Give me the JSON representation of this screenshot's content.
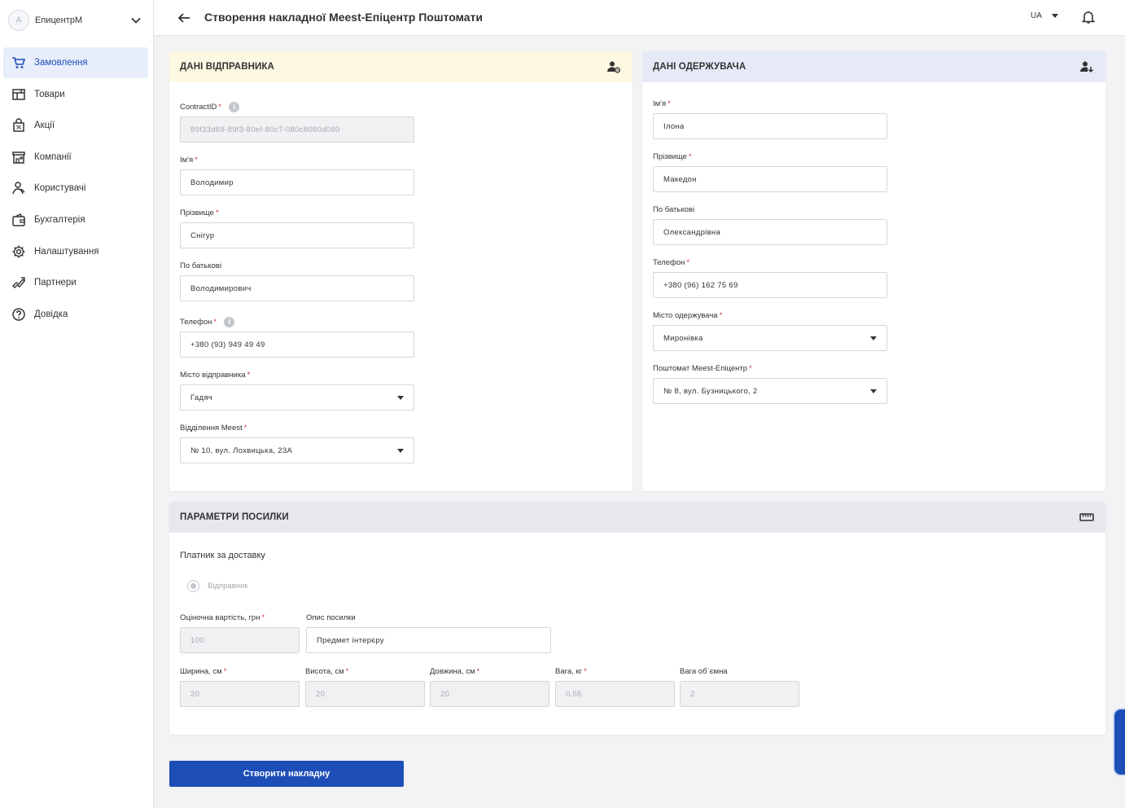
{
  "sidebar": {
    "account": {
      "avatar_letter": "A",
      "name": "ЕпицентрМ"
    },
    "items": [
      {
        "label": "Замовлення",
        "icon": "cart-icon",
        "active": true
      },
      {
        "label": "Товари",
        "icon": "store-icon"
      },
      {
        "label": "Акції",
        "icon": "promo-icon"
      },
      {
        "label": "Компанії",
        "icon": "building-icon"
      },
      {
        "label": "Користувачі",
        "icon": "users-icon"
      },
      {
        "label": "Бухгалтерія",
        "icon": "wallet-icon"
      },
      {
        "label": "Налаштування",
        "icon": "gear-icon"
      },
      {
        "label": "Партнери",
        "icon": "handshake-icon"
      },
      {
        "label": "Довідка",
        "icon": "help-icon"
      }
    ]
  },
  "header": {
    "title": "Створення накладної Meest-Епіцентр Поштомати",
    "lang": "UA"
  },
  "sender": {
    "title": "ДАНІ ВІДПРАВНИКА",
    "contract_label": "ContractID",
    "contract_value": "89f33d69-89f3-80ef-80c7-080c8080d080",
    "first_name_label": "Ім'я",
    "first_name": "Володимир",
    "last_name_label": "Прізвище",
    "last_name": "Снігур",
    "patronymic_label": "По батькові",
    "patronymic": "Володимирович",
    "phone_label": "Телефон",
    "phone": "+380 (93) 949 49 49",
    "city_label": "Місто відправника",
    "city": "Гадяч",
    "branch_label": "Відділення Meest",
    "branch": "№ 10, вул. Лохвицька, 23А"
  },
  "receiver": {
    "title": "ДАНІ ОДЕРЖУВАЧА",
    "first_name_label": "Ім'я",
    "first_name": "Ілона",
    "last_name_label": "Прізвище",
    "last_name": "Македон",
    "patronymic_label": "По батькові",
    "patronymic": "Олександрівна",
    "phone_label": "Телефон",
    "phone": "+380 (96) 162 75 69",
    "city_label": "Місто одержувача",
    "city": "Миронівка",
    "postomat_label": "Поштомат Meest-Епіцентр",
    "postomat": "№ 8, вул. Бузницького, 2"
  },
  "parcel": {
    "title": "ПАРАМЕТРИ ПОСИЛКИ",
    "payer_label": "Платник за доставку",
    "payer_option": "Відправник",
    "value_label": "Оціночна вартість, грн",
    "value": "100",
    "description_label": "Опис посилки",
    "description": "Предмет інтерєру",
    "width_label": "Ширина, см",
    "width": "20",
    "height_label": "Висота, см",
    "height": "20",
    "length_label": "Довжина, см",
    "length": "20",
    "weight_label": "Вага, кг",
    "weight": "0.55",
    "volume_weight_label": "Вага об`ємна",
    "volume_weight": "2"
  },
  "actions": {
    "submit_label": "Створити накладну"
  },
  "colors": {
    "primary": "#1d4eb8",
    "required": "#d23a3a",
    "sender_head": "#fdf8e2",
    "receiver_head": "#e5eaf6"
  }
}
